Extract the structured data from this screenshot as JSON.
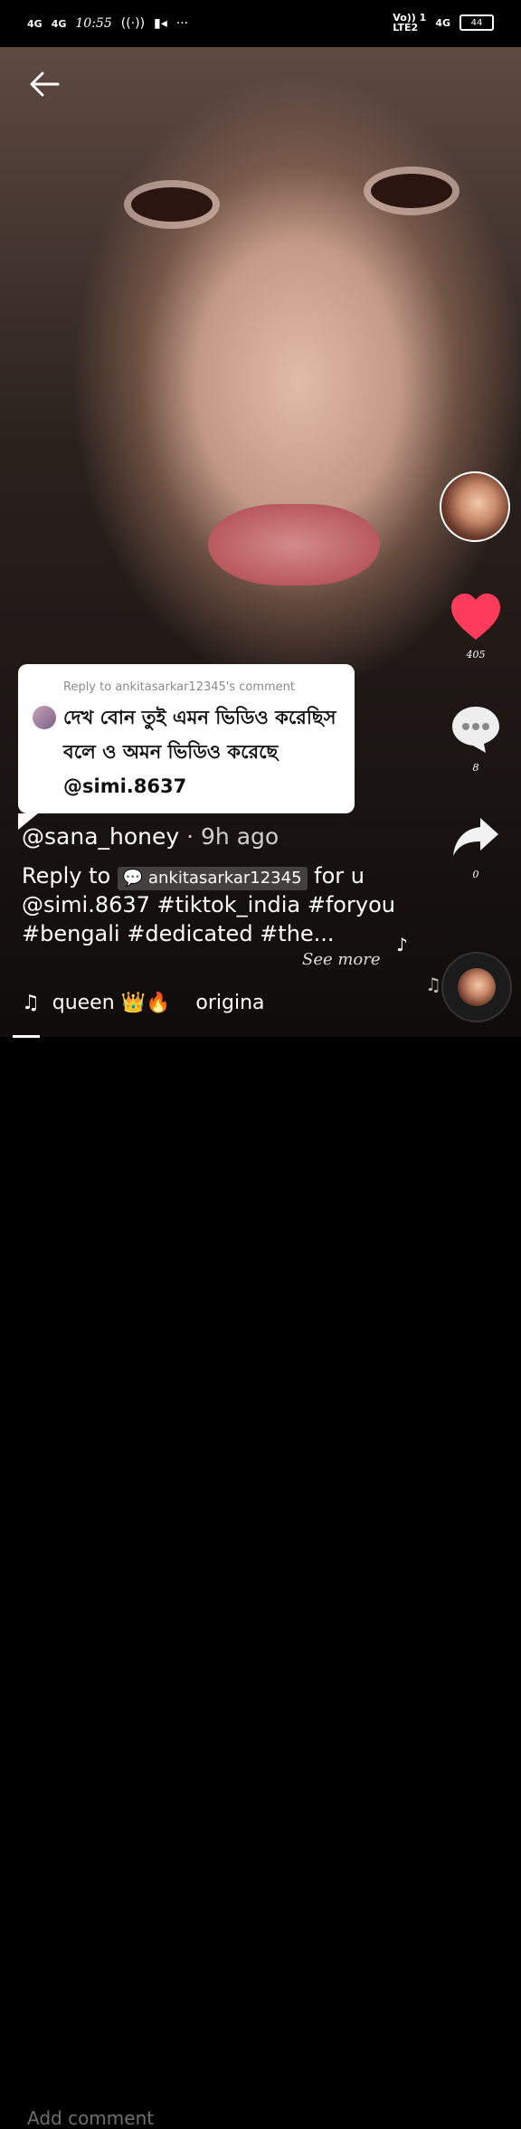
{
  "status_bar": {
    "signal1": "4G",
    "signal2": "4G",
    "time": "10:55",
    "volte": "Vo)) 1",
    "lte": "LTE2",
    "net": "4G",
    "battery": "44"
  },
  "video": {
    "reply_bubble": {
      "reply_to": "Reply to ankitasarkar12345's comment",
      "comment": "দেখ বোন তুই এমন ভিডিও করেছিস বলে ও অমন ভিডিও করেছে @simi.8637"
    },
    "actions": {
      "likes": "405",
      "comments": "8",
      "shares": "0"
    },
    "author": {
      "username": "@sana_honey",
      "time_ago": "· 9h ago"
    },
    "caption": {
      "prefix": "Reply to",
      "chip": "ankitasarkar12345",
      "rest": " for u @simi.8637 #tiktok_india #foryou #bengali #dedicated #the...",
      "see_more": "See more"
    },
    "music": {
      "title": "queen 👑🔥",
      "original": "origina"
    }
  },
  "comment_bar": {
    "placeholder": "Add comment"
  },
  "colors": {
    "like": "#ff3b5c",
    "background": "#000000"
  }
}
